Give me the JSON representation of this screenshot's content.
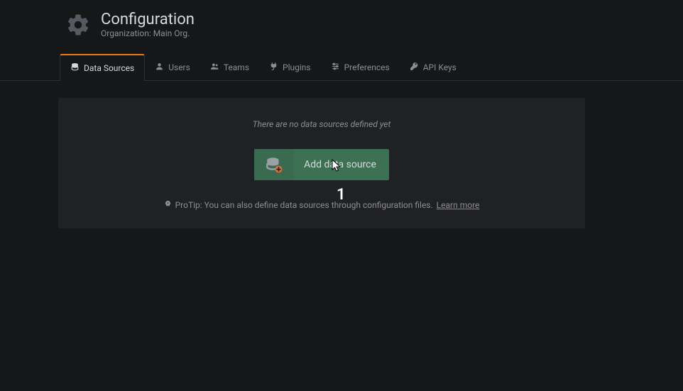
{
  "header": {
    "title": "Configuration",
    "subtitle": "Organization: Main Org."
  },
  "tabs": [
    {
      "label": "Data Sources",
      "name": "tab-data-sources",
      "icon": "database-icon",
      "active": true
    },
    {
      "label": "Users",
      "name": "tab-users",
      "icon": "user-icon",
      "active": false
    },
    {
      "label": "Teams",
      "name": "tab-teams",
      "icon": "users-icon",
      "active": false
    },
    {
      "label": "Plugins",
      "name": "tab-plugins",
      "icon": "plug-icon",
      "active": false
    },
    {
      "label": "Preferences",
      "name": "tab-preferences",
      "icon": "sliders-icon",
      "active": false
    },
    {
      "label": "API Keys",
      "name": "tab-api-keys",
      "icon": "key-icon",
      "active": false
    }
  ],
  "panel": {
    "empty_message": "There are no data sources defined yet",
    "add_button_label": "Add data source",
    "protip_text": "ProTip: You can also define data sources through configuration files.",
    "learn_more_label": "Learn more"
  },
  "overlay": {
    "annotation_number": "1"
  },
  "colors": {
    "accent_orange": "#eb7b18",
    "button_green": "#3d7154",
    "panel_bg": "#1f2124",
    "page_bg": "#161719"
  }
}
